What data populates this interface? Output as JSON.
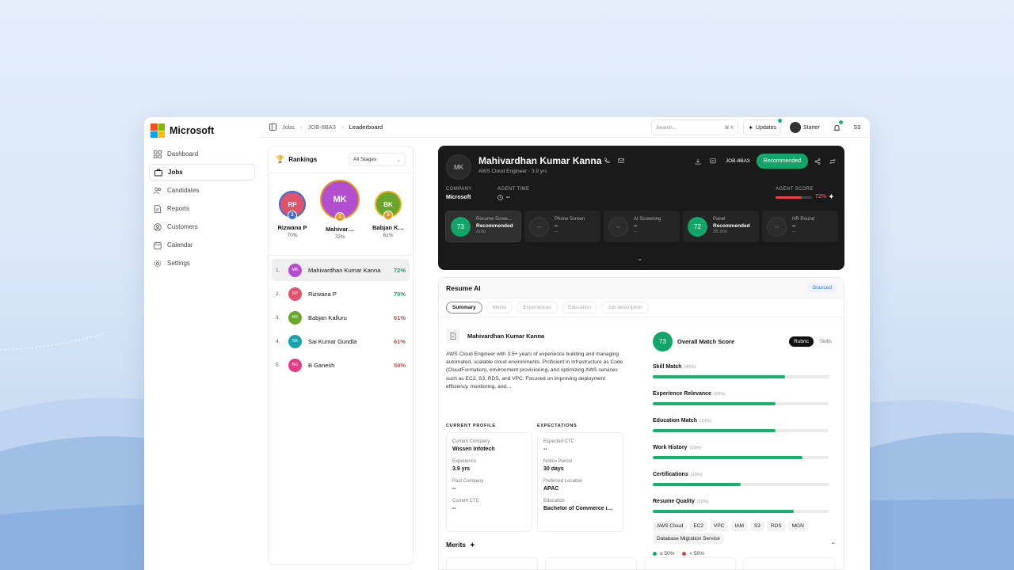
{
  "brand": {
    "name": "Microsoft"
  },
  "nav": {
    "items": [
      {
        "label": "Dashboard",
        "icon": "grid-icon",
        "active": false
      },
      {
        "label": "Jobs",
        "icon": "briefcase-icon",
        "active": true
      },
      {
        "label": "Candidates",
        "icon": "users-icon",
        "active": false
      },
      {
        "label": "Reports",
        "icon": "report-icon",
        "active": false
      },
      {
        "label": "Customers",
        "icon": "customers-icon",
        "active": false
      },
      {
        "label": "Calendar",
        "icon": "calendar-icon",
        "active": false
      },
      {
        "label": "Settings",
        "icon": "gear-icon",
        "active": false
      }
    ]
  },
  "breadcrumb": {
    "items": [
      "Jobs",
      "JOB-8BA3",
      "Leaderboard"
    ]
  },
  "topbar": {
    "search_placeholder": "Search...",
    "search_shortcut": "⌘ K",
    "updates_label": "Updates",
    "plan_label": "Starter",
    "user_initials": "SS"
  },
  "rankings": {
    "title": "Rankings",
    "stage_filter": "All Stages",
    "podium": [
      {
        "initials": "RP",
        "name": "Rizwana P",
        "pct": "70%",
        "rank": "2",
        "color": "#e0546b"
      },
      {
        "initials": "MK",
        "name": "Mahivar…",
        "pct": "72%",
        "rank": "1",
        "color": "#b24fd0"
      },
      {
        "initials": "BK",
        "name": "Babjan K…",
        "pct": "61%",
        "rank": "3",
        "color": "#6aa62e"
      }
    ],
    "list": [
      {
        "num": "1.",
        "initials": "MK",
        "name": "Mahivardhan Kumar Kanna",
        "pct": "72%",
        "color": "#b24fd0",
        "pct_color": "#12a56a"
      },
      {
        "num": "2.",
        "initials": "RP",
        "name": "Rizwana P",
        "pct": "70%",
        "color": "#e0546b",
        "pct_color": "#12a56a"
      },
      {
        "num": "3.",
        "initials": "BK",
        "name": "Babjan Kalluru",
        "pct": "61%",
        "color": "#6aa62e",
        "pct_color": "#e23d3d"
      },
      {
        "num": "4.",
        "initials": "SK",
        "name": "Sai Kumar Gundla",
        "pct": "61%",
        "color": "#1aa3a8",
        "pct_color": "#e23d3d"
      },
      {
        "num": "5.",
        "initials": "BG",
        "name": "B Ganesh",
        "pct": "50%",
        "color": "#e23d82",
        "pct_color": "#e23d3d"
      }
    ]
  },
  "candidate": {
    "initials": "MK",
    "name": "Mahivardhan Kumar Kanna",
    "subtitle": "AWS Cloud Engineer · 3.9 yrs",
    "job_id": "JOB-8BA3",
    "status": "Recommended",
    "company_label": "COMPANY",
    "company_value": "Microsoft",
    "agent_time_label": "AGENT TIME",
    "agent_time_value": "--",
    "agent_score_label": "AGENT SCORE",
    "agent_score_value": "72%",
    "agent_score_fraction": 0.72,
    "stages": [
      {
        "score": "73",
        "title": "Resume Scree…",
        "status": "Recommended",
        "extra": "Auto",
        "active": true
      },
      {
        "score": "--",
        "title": "Phone Screen",
        "status": "--",
        "extra": "--",
        "active": false
      },
      {
        "score": "--",
        "title": "AI Screening",
        "status": "--",
        "extra": "--",
        "active": false
      },
      {
        "score": "72",
        "title": "Panel",
        "status": "Recommended",
        "extra": "26 min",
        "active": false
      },
      {
        "score": "--",
        "title": "HR Round",
        "status": "--",
        "extra": "--",
        "active": false
      }
    ]
  },
  "resume_ai": {
    "title": "Resume AI",
    "badge": "Sourced",
    "tabs": [
      "Summary",
      "Merits",
      "Experiences",
      "Education",
      "Job description"
    ],
    "name": "Mahivardhan Kumar Kanna",
    "summary": "AWS Cloud Engineer with 3.5+ years of experience building and managing automated, scalable cloud environments. Proficient in Infrastructure as Code (CloudFormation), environment provisioning, and optimizing AWS services such as EC2, S3, RDS, and VPC. Focused on improving deployment efficiency, monitoring, and…",
    "current_profile_label": "CURRENT PROFILE",
    "expectations_label": "EXPECTATIONS",
    "current_profile": [
      {
        "label": "Current Company",
        "value": "Wissen Infotech"
      },
      {
        "label": "Experience",
        "value": "3.9 yrs"
      },
      {
        "label": "Past Company",
        "value": "--"
      },
      {
        "label": "Current CTC",
        "value": "--"
      }
    ],
    "expectations": [
      {
        "label": "Expected CTC",
        "value": "--"
      },
      {
        "label": "Notice Period",
        "value": "30 days"
      },
      {
        "label": "Preferred Location",
        "value": "APAC"
      },
      {
        "label": "Education",
        "value": "Bachelor of Commerce i…"
      }
    ],
    "match": {
      "score": "73",
      "title": "Overall Match Score",
      "toggle": [
        "Rubric",
        "Skills"
      ],
      "metrics": [
        {
          "label": "Skill Match",
          "weight": "(40%)",
          "value": 0.75
        },
        {
          "label": "Experience Relevance",
          "weight": "(20%)",
          "value": 0.7
        },
        {
          "label": "Education Match",
          "weight": "(10%)",
          "value": 0.7
        },
        {
          "label": "Work History",
          "weight": "(10%)",
          "value": 0.85
        },
        {
          "label": "Certifications",
          "weight": "(10%)",
          "value": 0.5
        },
        {
          "label": "Resume Quality",
          "weight": "(10%)",
          "value": 0.8
        }
      ],
      "skills": [
        "AWS Cloud",
        "EC2",
        "VPC",
        "IAM",
        "S3",
        "RDS",
        "MGN",
        "Database Migration Service"
      ],
      "legend": [
        {
          "label": "≥ 50%",
          "color": "#12a56a"
        },
        {
          "label": "< 50%",
          "color": "#e23d3d"
        }
      ]
    },
    "merits_label": "Merits"
  }
}
